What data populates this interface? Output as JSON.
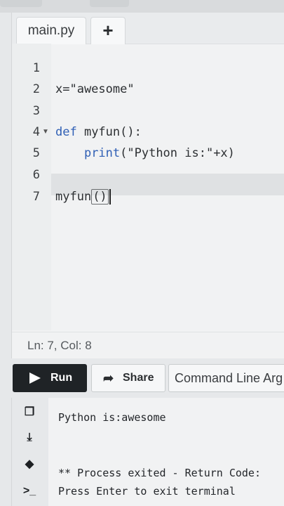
{
  "editor": {
    "tab_label": "main.py",
    "add_tab_label": "+",
    "line_numbers": [
      "1",
      "2",
      "3",
      "4",
      "5",
      "6",
      "7"
    ],
    "code": {
      "line2": "x=\"awesome\"",
      "line4_kw": "def",
      "line4_rest": " myfun():",
      "line5_indent": "    ",
      "line5_fn": "print",
      "line5_rest": "(\"Python is:\"+x)",
      "line7_name": "myfun",
      "line7_parens": "()"
    },
    "status": "Ln: 7,  Col: 8"
  },
  "toolbar": {
    "run_label": "Run",
    "share_label": "Share",
    "command_line_label": "Command Line Arg"
  },
  "terminal": {
    "lines": [
      "Python is:awesome",
      "",
      "",
      "** Process exited - Return Code:",
      "Press Enter to exit terminal"
    ]
  }
}
